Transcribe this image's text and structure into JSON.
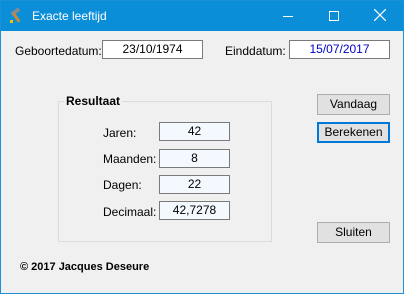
{
  "window": {
    "title": "Exacte leeftijd",
    "icon": "hammer-icon",
    "accent": "#0b8ed8"
  },
  "dates": {
    "birth_label": "Geboortedatum:",
    "birth_value": "23/10/1974",
    "end_label": "Einddatum:",
    "end_value": "15/07/2017"
  },
  "result": {
    "title": "Resultaat",
    "rows": [
      {
        "label": "Jaren:",
        "value": "42"
      },
      {
        "label": "Maanden:",
        "value": "8"
      },
      {
        "label": "Dagen:",
        "value": "22"
      },
      {
        "label": "Decimaal:",
        "value": "42,7278"
      }
    ]
  },
  "buttons": {
    "today": "Vandaag",
    "calculate": "Berekenen",
    "close": "Sluiten"
  },
  "footer": {
    "copyright": "© 2017 Jacques Deseure"
  }
}
